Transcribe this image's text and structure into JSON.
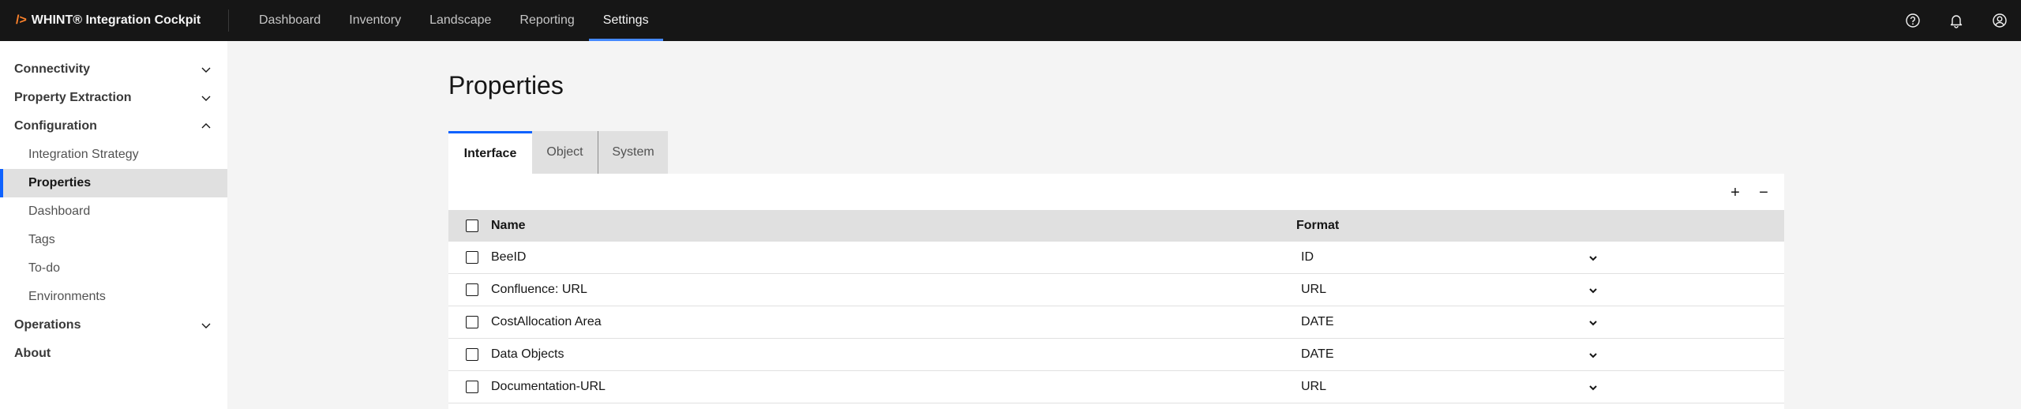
{
  "app": {
    "brand_prefix": "/>",
    "brand_name": "WHINT® Integration Cockpit"
  },
  "nav": {
    "items": [
      {
        "label": "Dashboard",
        "active": false
      },
      {
        "label": "Inventory",
        "active": false
      },
      {
        "label": "Landscape",
        "active": false
      },
      {
        "label": "Reporting",
        "active": false
      },
      {
        "label": "Settings",
        "active": true
      }
    ]
  },
  "top_icons": [
    "help-icon",
    "notification-icon",
    "user-avatar-icon"
  ],
  "sidebar": {
    "connectivity": "Connectivity",
    "property_extraction": "Property Extraction",
    "configuration": "Configuration",
    "configuration_items": [
      {
        "label": "Integration Strategy"
      },
      {
        "label": "Properties",
        "active": true
      },
      {
        "label": "Dashboard"
      },
      {
        "label": "Tags"
      },
      {
        "label": "To-do"
      },
      {
        "label": "Environments"
      }
    ],
    "operations": "Operations",
    "about": "About"
  },
  "page": {
    "title": "Properties",
    "tabs": [
      {
        "label": "Interface",
        "active": true
      },
      {
        "label": "Object",
        "active": false
      },
      {
        "label": "System",
        "active": false
      }
    ]
  },
  "toolbar": {
    "add_label": "+",
    "remove_label": "−"
  },
  "table": {
    "headers": {
      "name": "Name",
      "format": "Format"
    },
    "rows": [
      {
        "name": "BeeID",
        "format": "ID"
      },
      {
        "name": "Confluence: URL",
        "format": "URL"
      },
      {
        "name": "CostAllocation Area",
        "format": "DATE"
      },
      {
        "name": "Data Objects",
        "format": "DATE"
      },
      {
        "name": "Documentation-URL",
        "format": "URL"
      }
    ]
  },
  "colors": {
    "accent": "#0f62fe",
    "active_nav_underline": "#4589ff",
    "topbar_bg": "#161616",
    "brand_slash": "#ff832b"
  }
}
